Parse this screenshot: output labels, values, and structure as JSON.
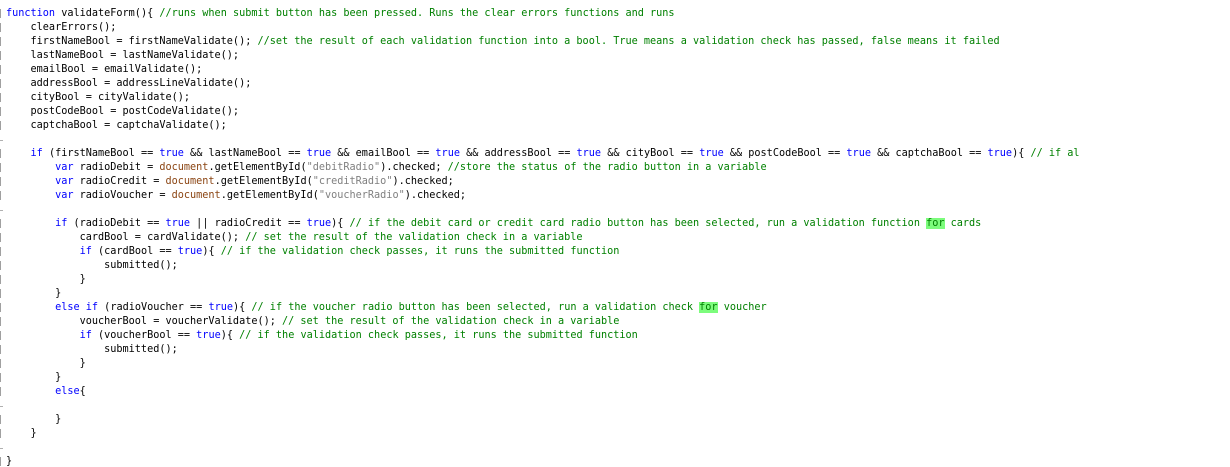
{
  "editor": {
    "lines": [
      [
        {
          "t": "function",
          "c": "kw"
        },
        {
          "t": " validateForm(){ "
        },
        {
          "t": "//runs when submit button has been pressed. Runs the clear errors functions and runs",
          "c": "cm"
        }
      ],
      [
        {
          "t": "    clearErrors();"
        }
      ],
      [
        {
          "t": "    firstNameBool = firstNameValidate(); "
        },
        {
          "t": "//set the result of each validation function into a bool. True means a validation check has passed, false means it failed",
          "c": "cm"
        }
      ],
      [
        {
          "t": "    lastNameBool = lastNameValidate();"
        }
      ],
      [
        {
          "t": "    emailBool = emailValidate();"
        }
      ],
      [
        {
          "t": "    addressBool = addressLineValidate();"
        }
      ],
      [
        {
          "t": "    cityBool = cityValidate();"
        }
      ],
      [
        {
          "t": "    postCodeBool = postCodeValidate();"
        }
      ],
      [
        {
          "t": "    captchaBool = captchaValidate();"
        }
      ],
      [
        {
          "t": ""
        }
      ],
      [
        {
          "t": "    "
        },
        {
          "t": "if",
          "c": "kw"
        },
        {
          "t": " (firstNameBool == "
        },
        {
          "t": "true",
          "c": "bool"
        },
        {
          "t": " && lastNameBool == "
        },
        {
          "t": "true",
          "c": "bool"
        },
        {
          "t": " && emailBool == "
        },
        {
          "t": "true",
          "c": "bool"
        },
        {
          "t": " && addressBool == "
        },
        {
          "t": "true",
          "c": "bool"
        },
        {
          "t": " && cityBool == "
        },
        {
          "t": "true",
          "c": "bool"
        },
        {
          "t": " && postCodeBool == "
        },
        {
          "t": "true",
          "c": "bool"
        },
        {
          "t": " && captchaBool == "
        },
        {
          "t": "true",
          "c": "bool"
        },
        {
          "t": "){ "
        },
        {
          "t": "// if al",
          "c": "cm"
        }
      ],
      [
        {
          "t": "        "
        },
        {
          "t": "var",
          "c": "kw"
        },
        {
          "t": " radioDebit = "
        },
        {
          "t": "document",
          "c": "glob"
        },
        {
          "t": ".getElementById("
        },
        {
          "t": "\"debitRadio\"",
          "c": "str"
        },
        {
          "t": ").checked; "
        },
        {
          "t": "//store the status of the radio button in a variable",
          "c": "cm"
        }
      ],
      [
        {
          "t": "        "
        },
        {
          "t": "var",
          "c": "kw"
        },
        {
          "t": " radioCredit = "
        },
        {
          "t": "document",
          "c": "glob"
        },
        {
          "t": ".getElementById("
        },
        {
          "t": "\"creditRadio\"",
          "c": "str"
        },
        {
          "t": ").checked;"
        }
      ],
      [
        {
          "t": "        "
        },
        {
          "t": "var",
          "c": "kw"
        },
        {
          "t": " radioVoucher = "
        },
        {
          "t": "document",
          "c": "glob"
        },
        {
          "t": ".getElementById("
        },
        {
          "t": "\"voucherRadio\"",
          "c": "str"
        },
        {
          "t": ").checked;"
        }
      ],
      [
        {
          "t": ""
        }
      ],
      [
        {
          "t": "        "
        },
        {
          "t": "if",
          "c": "kw"
        },
        {
          "t": " (radioDebit == "
        },
        {
          "t": "true",
          "c": "bool"
        },
        {
          "t": " || radioCredit == "
        },
        {
          "t": "true",
          "c": "bool"
        },
        {
          "t": "){ "
        },
        {
          "t": "// if the debit card or credit card radio button has been selected, run a validation function ",
          "c": "cm"
        },
        {
          "t": "for",
          "c": "cm hl"
        },
        {
          "t": " cards",
          "c": "cm"
        }
      ],
      [
        {
          "t": "            cardBool = cardValidate(); "
        },
        {
          "t": "// set the result of the validation check in a variable",
          "c": "cm"
        }
      ],
      [
        {
          "t": "            "
        },
        {
          "t": "if",
          "c": "kw"
        },
        {
          "t": " (cardBool == "
        },
        {
          "t": "true",
          "c": "bool"
        },
        {
          "t": "){ "
        },
        {
          "t": "// if the validation check passes, it runs the submitted function",
          "c": "cm"
        }
      ],
      [
        {
          "t": "                submitted();"
        }
      ],
      [
        {
          "t": "            }"
        }
      ],
      [
        {
          "t": "        }"
        }
      ],
      [
        {
          "t": "        "
        },
        {
          "t": "else",
          "c": "kw"
        },
        {
          "t": " "
        },
        {
          "t": "if",
          "c": "kw"
        },
        {
          "t": " (radioVoucher == "
        },
        {
          "t": "true",
          "c": "bool"
        },
        {
          "t": "){ "
        },
        {
          "t": "// if the voucher radio button has been selected, run a validation check ",
          "c": "cm"
        },
        {
          "t": "for",
          "c": "cm hl"
        },
        {
          "t": " voucher",
          "c": "cm"
        }
      ],
      [
        {
          "t": "            voucherBool = voucherValidate(); "
        },
        {
          "t": "// set the result of the validation check in a variable",
          "c": "cm"
        }
      ],
      [
        {
          "t": "            "
        },
        {
          "t": "if",
          "c": "kw"
        },
        {
          "t": " (voucherBool == "
        },
        {
          "t": "true",
          "c": "bool"
        },
        {
          "t": "){ "
        },
        {
          "t": "// if the validation check passes, it runs the submitted function",
          "c": "cm"
        }
      ],
      [
        {
          "t": "                submitted();"
        }
      ],
      [
        {
          "t": "            }"
        }
      ],
      [
        {
          "t": "        }"
        }
      ],
      [
        {
          "t": "        "
        },
        {
          "t": "else",
          "c": "kw"
        },
        {
          "t": "{"
        }
      ],
      [
        {
          "t": ""
        }
      ],
      [
        {
          "t": "        }"
        }
      ],
      [
        {
          "t": "    }"
        }
      ],
      [
        {
          "t": ""
        }
      ],
      [
        {
          "t": "}"
        }
      ]
    ],
    "colors": {
      "keyword": "#0000ff",
      "comment": "#008000",
      "string": "#808080",
      "global": "#8b4513",
      "highlight": "#7cfc7c"
    }
  }
}
